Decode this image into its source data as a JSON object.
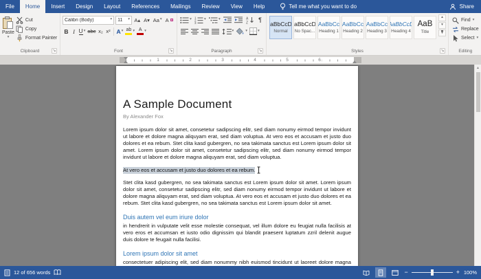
{
  "colors": {
    "accent": "#2b579a",
    "doc_heading": "#2e74b5",
    "highlight_color": "#ffe400",
    "font_color": "#c00000",
    "selection": "#c9d1da"
  },
  "glyphs": {
    "down": "▾",
    "up": "▴",
    "launcher": "↘",
    "pilcrow_btn": "¶"
  },
  "tabs": {
    "file": "File",
    "active": "Home",
    "items": [
      "Home",
      "Insert",
      "Design",
      "Layout",
      "References",
      "Mailings",
      "Review",
      "View",
      "Help"
    ]
  },
  "tellme": {
    "text": "Tell me what you want to do"
  },
  "titlebar": {
    "share": "Share"
  },
  "ribbon": {
    "clipboard": {
      "label": "Clipboard",
      "paste": "Paste",
      "cut": "Cut",
      "copy": "Copy",
      "format_painter": "Format Painter"
    },
    "font": {
      "label": "Font",
      "family": "Calibri (Body)",
      "size": "11",
      "grow": "A▴",
      "shrink": "A▾",
      "change_case": "Aa",
      "clear": "A",
      "bold": "B",
      "italic": "I",
      "underline": "U",
      "strike": "abc",
      "subscript": "x₂",
      "superscript": "x²",
      "effects": "A",
      "highlight": "ab",
      "color": "A"
    },
    "paragraph": {
      "label": "Paragraph"
    },
    "styles": {
      "label": "Styles",
      "items": [
        {
          "preview": "AaBbCcDd",
          "name": "Normal"
        },
        {
          "preview": "AaBbCcDd",
          "name": "No Spac..."
        },
        {
          "preview": "AaBbCc",
          "name": "Heading 1"
        },
        {
          "preview": "AaBbCc",
          "name": "Heading 2"
        },
        {
          "preview": "AaBbCc",
          "name": "Heading 3"
        },
        {
          "preview": "AaBbCcD",
          "name": "Heading 4"
        },
        {
          "preview": "AaB",
          "name": "Title"
        }
      ]
    },
    "editing": {
      "label": "Editing",
      "find": "Find",
      "replace": "Replace",
      "select": "Select"
    }
  },
  "ruler": {
    "numbers": [
      "1",
      "2",
      "3",
      "4",
      "5",
      "6"
    ]
  },
  "document": {
    "title": "A Sample Document",
    "byline": "By Alexander Fox",
    "para1": "Lorem ipsum dolor sit amet, consetetur sadipscing elitr, sed diam nonumy eirmod tempor invidunt ut labore et dolore magna aliquyam erat, sed diam voluptua. At vero eos et accusam et justo duo dolores et ea rebum. Stet clita kasd gubergren, no sea takimata sanctus est Lorem ipsum dolor sit amet. Lorem ipsum dolor sit amet, consetetur sadipscing elitr, sed diam nonumy eirmod tempor invidunt ut labore et dolore magna aliquyam erat, sed diam voluptua.",
    "selection": "At vero eos et accusam et justo duo dolores et ea rebum. ",
    "para2": "Stet clita kasd gubergren, no sea takimata sanctus est Lorem ipsum dolor sit amet. Lorem ipsum dolor sit amet, consetetur sadipscing elitr, sed diam nonumy eirmod tempor invidunt ut labore et dolore magna aliquyam erat, sed diam voluptua. At vero eos et accusam et justo duo dolores et ea rebum. Stet clita kasd gubergren, no sea takimata sanctus est Lorem ipsum dolor sit amet.",
    "heading1": "Duis autem vel eum iriure dolor",
    "para3": "in hendrerit in vulputate velit esse molestie consequat, vel illum dolore eu feugiat nulla facilisis at vero eros et accumsan et iusto odio dignissim qui blandit praesent luptatum zzril delenit augue duis dolore te feugait nulla facilisi.",
    "heading2": "Lorem ipsum dolor sit amet",
    "para4": "consectetuer adipiscing elit, sed diam nonummy nibh euismod tincidunt ut laoreet dolore magna aliquam erat volutpat."
  },
  "statusbar": {
    "words": "12 of 656 words",
    "zoom_out": "−",
    "zoom_in": "+",
    "zoom": "100%"
  }
}
